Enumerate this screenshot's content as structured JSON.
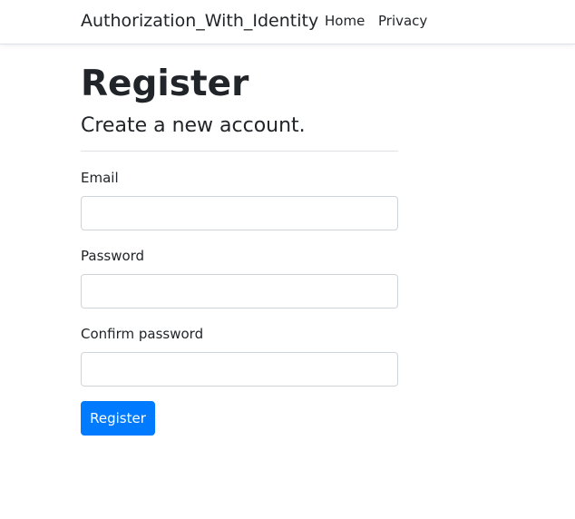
{
  "navbar": {
    "brand": "Authorization_With_Identity",
    "links": [
      "Home",
      "Privacy"
    ]
  },
  "page": {
    "title": "Register",
    "subtitle": "Create a new account."
  },
  "form": {
    "email_label": "Email",
    "email_value": "",
    "password_label": "Password",
    "password_value": "",
    "confirm_label": "Confirm password",
    "confirm_value": "",
    "submit_label": "Register"
  },
  "colors": {
    "primary": "#007bff",
    "border": "#ced4da",
    "text": "#212529"
  }
}
